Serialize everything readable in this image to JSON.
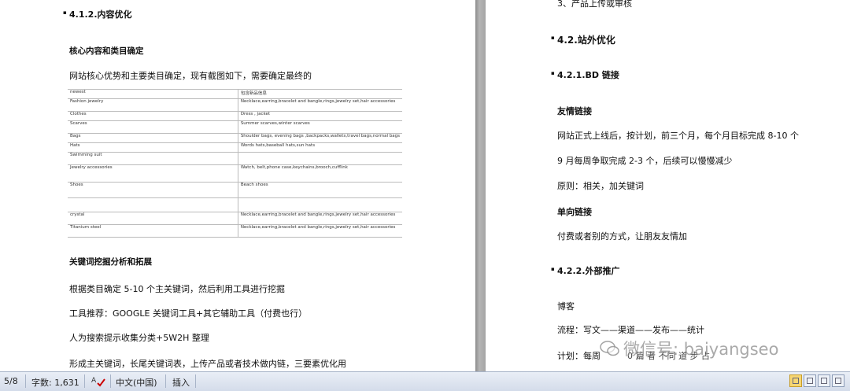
{
  "left_page": {
    "heading_content": "4.1.2.内容优化",
    "heading_core": "核心内容和类目确定",
    "intro": "网站核心优势和主要类目确定，现有截图如下，需要确定最终的",
    "table_rows": [
      [
        "newest",
        "包含新品信息"
      ],
      [
        "Fashion jewelry",
        "Necklace,earring,bracelet and bangle,rings,jewelry set,hair accessories"
      ],
      [
        "Clothes",
        "Dress , jacket"
      ],
      [
        "Scarves",
        "Summer scarves,winter scarves"
      ],
      [
        "Bags",
        "Shoulder bags, evening bags ,backpacks,wallets,travel bags,normal bags"
      ],
      [
        "Hats",
        "Words hats,baseball hats,sun hats"
      ],
      [
        "Swimming suit",
        ""
      ],
      [
        "Jewelry accessories",
        "Watch, belt,phone case,keychains,brooch,cufflink"
      ],
      [
        "Shoes",
        "Beach shoes"
      ],
      [
        "",
        ""
      ],
      [
        "crystal",
        "Necklace,earring,bracelet and bangle,rings,jewelry set,hair accessories"
      ],
      [
        "Titanium steel",
        "Necklace,earring,bracelet and bangle,rings,jewelry set,hair accessories"
      ]
    ],
    "heading_keywords": "关键词挖掘分析和拓展",
    "para1": "根据类目确定 5-10 个主关键词，然后利用工具进行挖掘",
    "para2": "工具推荐：GOOGLE  关键词工具+其它辅助工具（付费也行）",
    "para3": "人为搜索提示收集分类+5W2H 整理",
    "para4": "形成主关键词，长尾关键词表，上传产品或者技术做内链，三要素优化用"
  },
  "right_page": {
    "top_line": "3、产品上传或审核",
    "heading_offsite": "4.2.站外优化",
    "heading_bd": "4.2.1.BD 链接",
    "friend_links": "友情链接",
    "p1": "网站正式上线后，按计划，前三个月，每个月目标完成 8-10 个",
    "p2": "9 月每周争取完成 2-3 个，后续可以慢慢减少",
    "p3": "原则：相关，加关键词",
    "one_way": "单向链接",
    "p4": "付费或者别的方式，让朋友友情加",
    "heading_promo": "4.2.2.外部推广",
    "blog": "博客",
    "flow": "流程：写文——渠道——发布——统计",
    "plan": "计划：每周",
    "plan_tail": "0  篇     者   不同  道    步    占"
  },
  "watermark": "微信号: baiyangseo",
  "status_bar": {
    "page": "5/8",
    "word_count": "字数: 1,631",
    "language": "中文(中国)",
    "mode": "插入"
  }
}
